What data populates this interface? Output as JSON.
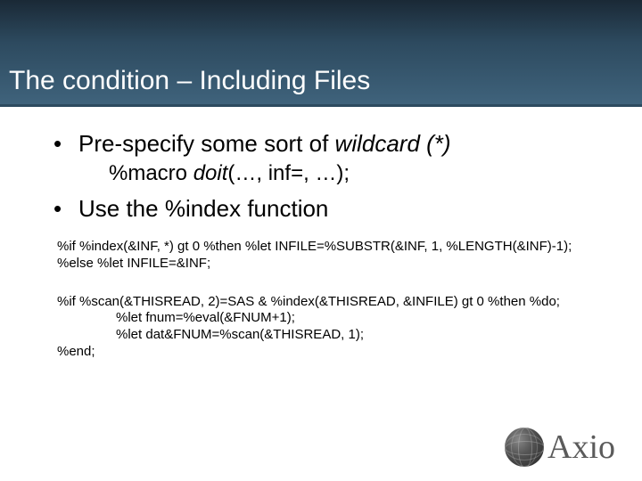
{
  "title": "The condition – Including Files",
  "bullet1_prefix": "Pre-specify some sort of ",
  "bullet1_italic": "wildcard (*)",
  "subline_prefix": "%macro ",
  "subline_italic": "doit",
  "subline_suffix": "(…, inf=, …);",
  "bullet2": "Use the %index function",
  "code1_line1": "%if %index(&INF, *) gt 0 %then %let INFILE=%SUBSTR(&INF, 1, %LENGTH(&INF)-1);",
  "code1_line2": "%else %let INFILE=&INF;",
  "code2_line1": "%if %scan(&THISREAD, 2)=SAS & %index(&THISREAD, &INFILE) gt 0 %then %do;",
  "code2_line2": "%let fnum=%eval(&FNUM+1);",
  "code2_line3": "%let dat&FNUM=%scan(&THISREAD, 1);",
  "code2_line4": "%end;",
  "logo_text": "Axio"
}
